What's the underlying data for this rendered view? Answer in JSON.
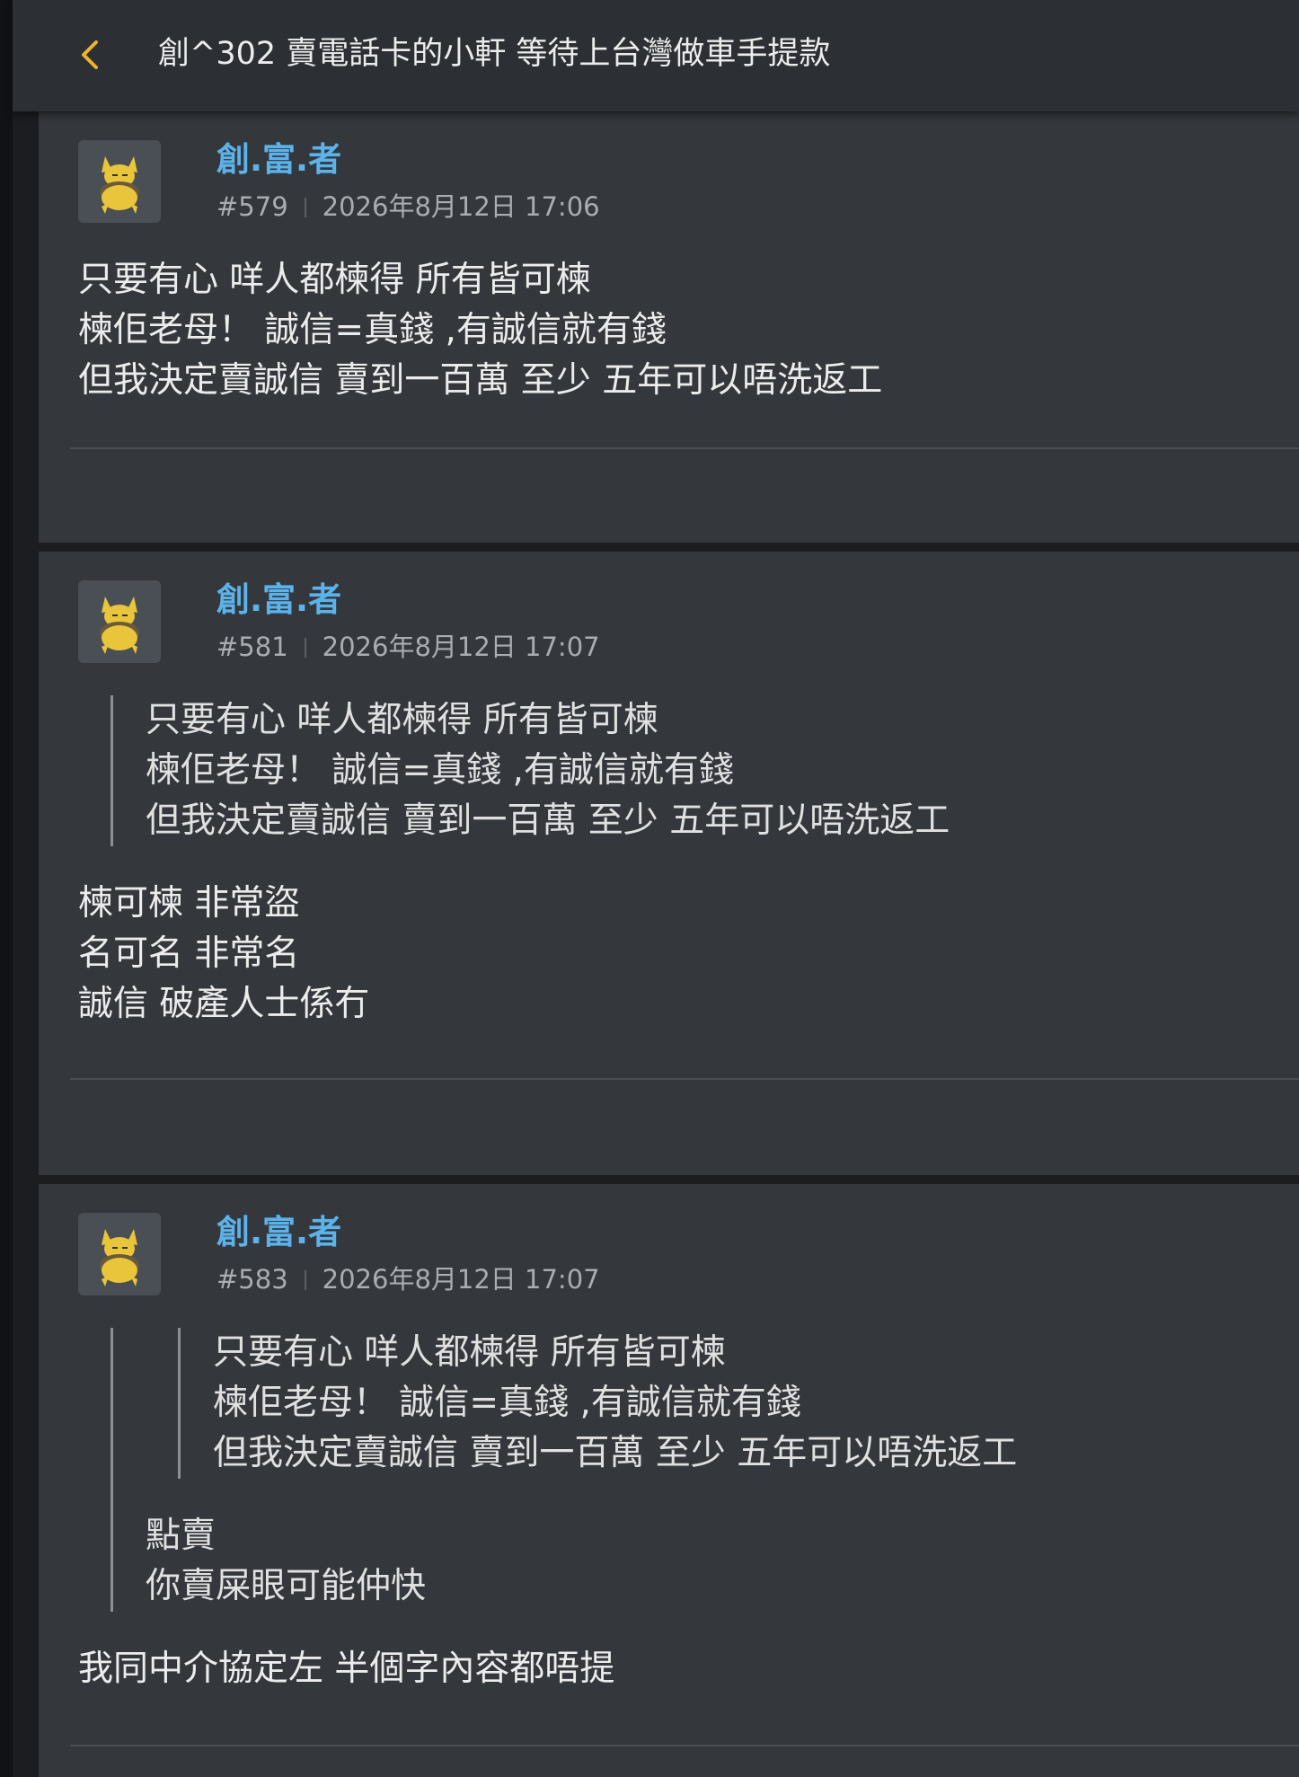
{
  "header": {
    "back_icon": "chevron-left-icon",
    "title": "創^302 賣電話卡的小軒 等待上台灣做車手提款",
    "accent_color": "#f0b429"
  },
  "posts": [
    {
      "username": "創.富.者",
      "number": "#579",
      "timestamp": "2026年8月12日 17:06",
      "avatar_icon": "pokemon-abra-avatar-icon",
      "body": [
        "只要有心 咩人都楝得 所有皆可楝",
        "楝佢老母！ 誠信=真錢 ,有誠信就有錢",
        "但我決定賣誠信 賣到一百萬 至少 五年可以唔洗返工"
      ]
    },
    {
      "username": "創.富.者",
      "number": "#581",
      "timestamp": "2026年8月12日 17:07",
      "avatar_icon": "pokemon-abra-avatar-icon",
      "quote": [
        "只要有心 咩人都楝得 所有皆可楝",
        "楝佢老母！ 誠信=真錢 ,有誠信就有錢",
        "但我決定賣誠信 賣到一百萬 至少 五年可以唔洗返工"
      ],
      "body": [
        "楝可楝 非常盜",
        "名可名 非常名",
        "誠信 破產人士係冇"
      ]
    },
    {
      "username": "創.富.者",
      "number": "#583",
      "timestamp": "2026年8月12日 17:07",
      "avatar_icon": "pokemon-abra-avatar-icon",
      "nested_quote": [
        "只要有心 咩人都楝得 所有皆可楝",
        "楝佢老母！ 誠信=真錢 ,有誠信就有錢",
        "但我決定賣誠信 賣到一百萬 至少 五年可以唔洗返工"
      ],
      "quote": [
        "點賣",
        "你賣屎眼可能仲快"
      ],
      "body": [
        "我同中介協定左 半個字內容都唔提"
      ]
    }
  ]
}
